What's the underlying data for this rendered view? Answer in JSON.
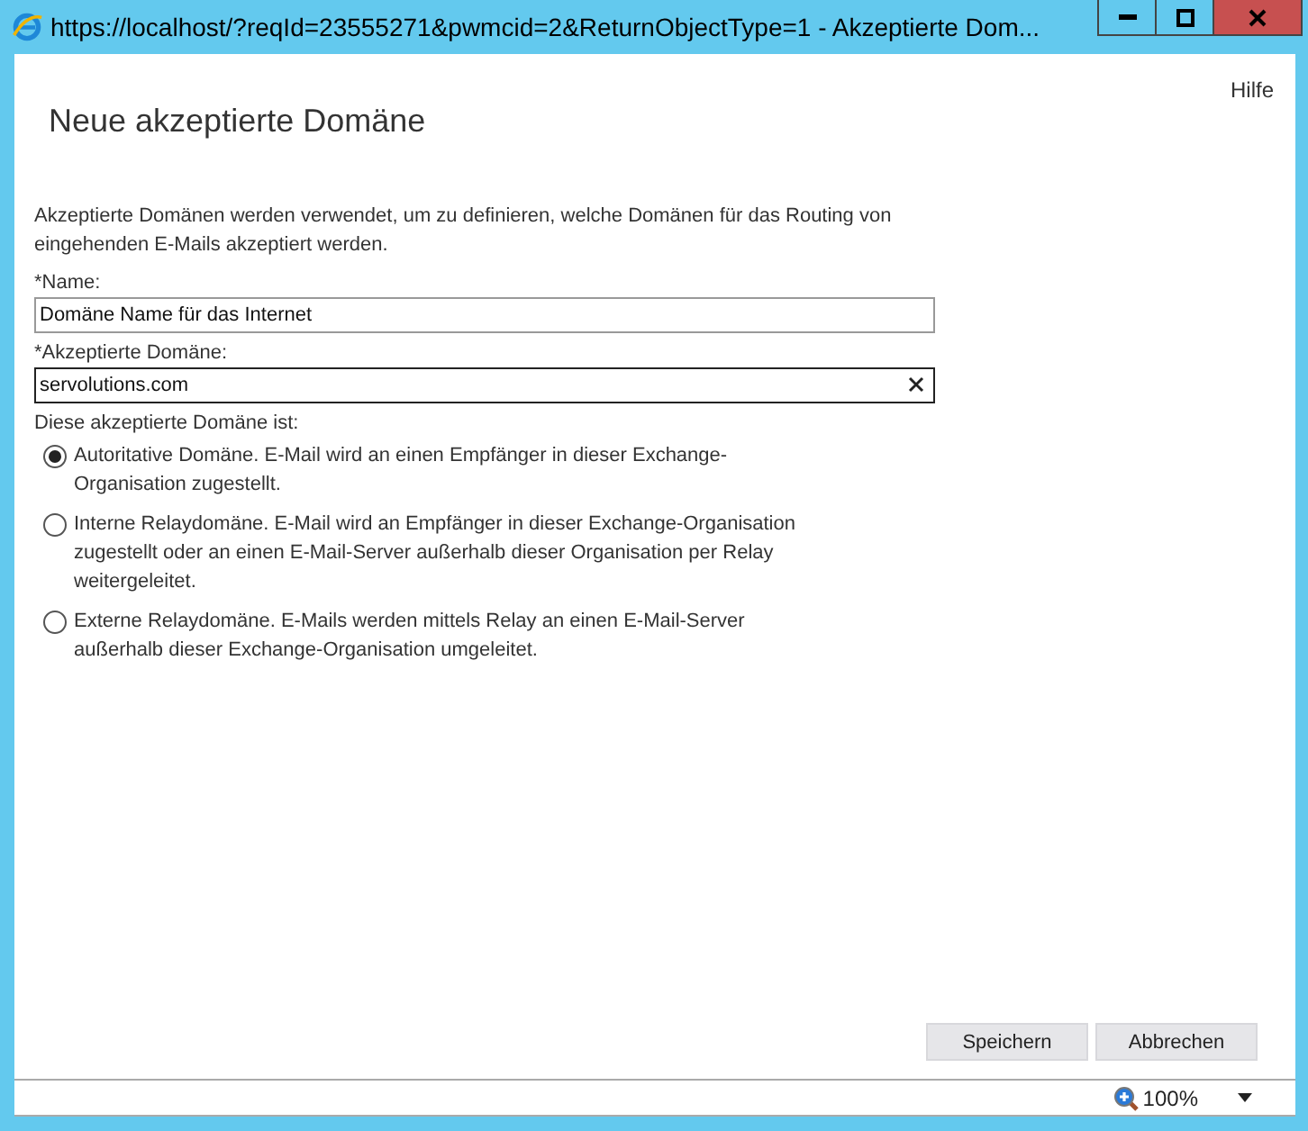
{
  "window": {
    "title": "https://localhost/?reqId=23555271&pwmcid=2&ReturnObjectType=1 - Akzeptierte Dom..."
  },
  "help_link": "Hilfe",
  "heading": "Neue akzeptierte Domäne",
  "description": "Akzeptierte Domänen werden verwendet, um zu definieren, welche Domänen für das Routing von eingehenden E-Mails akzeptiert werden.",
  "fields": [
    {
      "label": "*Name:",
      "value": "Domäne Name für das Internet",
      "clearable": false
    },
    {
      "label": "*Akzeptierte Domäne:",
      "value": "servolutions.com",
      "clearable": true
    }
  ],
  "domain_type": {
    "label": "Diese akzeptierte Domäne ist:",
    "options": [
      {
        "label": "Autoritative Domäne. E-Mail wird an einen Empfänger in dieser Exchange-Organisation zugestellt.",
        "selected": true
      },
      {
        "label": "Interne Relaydomäne. E-Mail wird an Empfänger in dieser Exchange-Organisation zugestellt oder an einen E-Mail-Server außerhalb dieser Organisation per Relay weitergeleitet.",
        "selected": false
      },
      {
        "label": "Externe Relaydomäne. E-Mails werden mittels Relay an einen E-Mail-Server außerhalb dieser Exchange-Organisation umgeleitet.",
        "selected": false
      }
    ]
  },
  "buttons": [
    "Speichern",
    "Abbrechen"
  ],
  "status_bar": {
    "zoom": "100%"
  }
}
